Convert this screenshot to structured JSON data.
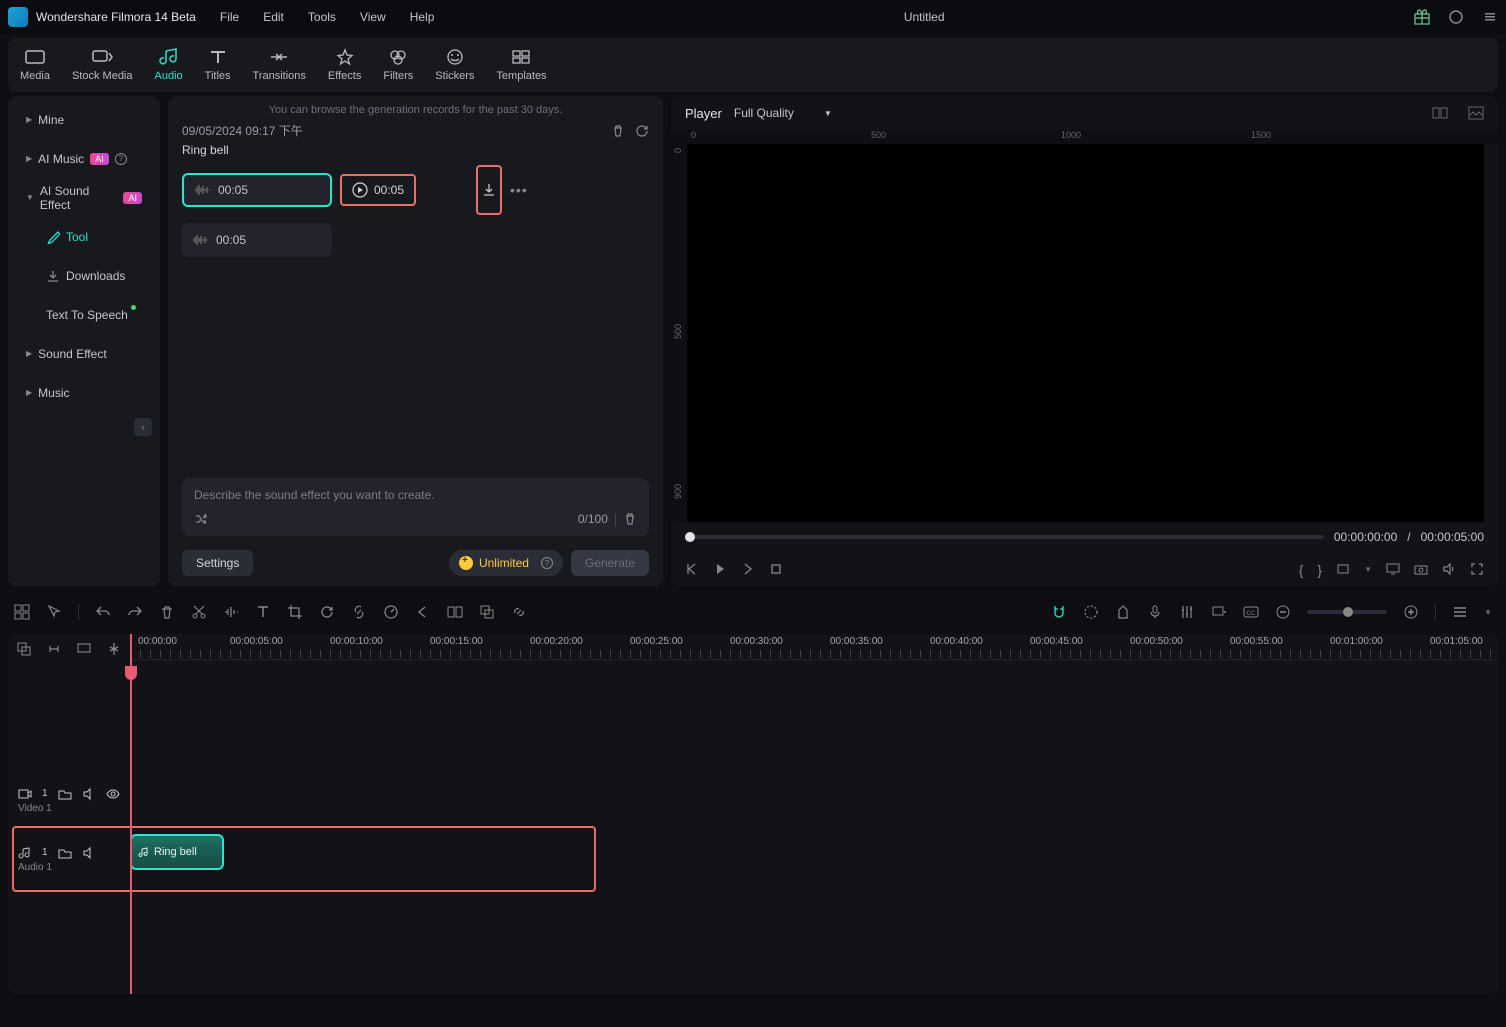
{
  "app": {
    "title": "Wondershare Filmora 14 Beta",
    "project": "Untitled"
  },
  "menu": {
    "file": "File",
    "edit": "Edit",
    "tools": "Tools",
    "view": "View",
    "help": "Help"
  },
  "toolbar": [
    {
      "label": "Media"
    },
    {
      "label": "Stock Media"
    },
    {
      "label": "Audio"
    },
    {
      "label": "Titles"
    },
    {
      "label": "Transitions"
    },
    {
      "label": "Effects"
    },
    {
      "label": "Filters"
    },
    {
      "label": "Stickers"
    },
    {
      "label": "Templates"
    }
  ],
  "sidebar": {
    "items": [
      {
        "label": "Mine"
      },
      {
        "label": "AI Music",
        "ai": true,
        "help": true
      },
      {
        "label": "AI Sound Effect",
        "ai": true
      },
      {
        "label": "Tool"
      },
      {
        "label": "Downloads"
      },
      {
        "label": "Text To Speech",
        "notify": true
      },
      {
        "label": "Sound Effect"
      },
      {
        "label": "Music"
      }
    ]
  },
  "mid": {
    "info": "You can browse the generation records for the past 30 days.",
    "date": "09/05/2024 09:17 下午",
    "title": "Ring bell",
    "clips": [
      {
        "dur": "00:05",
        "sel": true,
        "play_dur": "00:05"
      },
      {
        "dur": "00:05"
      }
    ],
    "prompt_placeholder": "Describe the sound effect you want to create.",
    "char_count": "0/100",
    "settings_label": "Settings",
    "unlimited_label": "Unlimited",
    "generate_label": "Generate"
  },
  "player": {
    "tab": "Player",
    "quality": "Full Quality",
    "ruler_h": [
      "0",
      "500",
      "1000",
      "1500"
    ],
    "ruler_v": [
      "0",
      "500",
      "900"
    ],
    "t_cur": "00:00:00:00",
    "t_total": "00:00:05:00",
    "t_sep": "/"
  },
  "timeline": {
    "marks": [
      "00:00:00",
      "00:00:05:00",
      "00:00:10:00",
      "00:00:15:00",
      "00:00:20:00",
      "00:00:25:00",
      "00:00:30:00",
      "00:00:35:00",
      "00:00:40:00",
      "00:00:45:00",
      "00:00:50:00",
      "00:00:55:00",
      "00:01:00:00",
      "00:01:05:00"
    ],
    "video_track": {
      "num": "1",
      "label": "Video 1"
    },
    "audio_track": {
      "num": "1",
      "label": "Audio 1",
      "clip_name": "Ring bell"
    }
  }
}
